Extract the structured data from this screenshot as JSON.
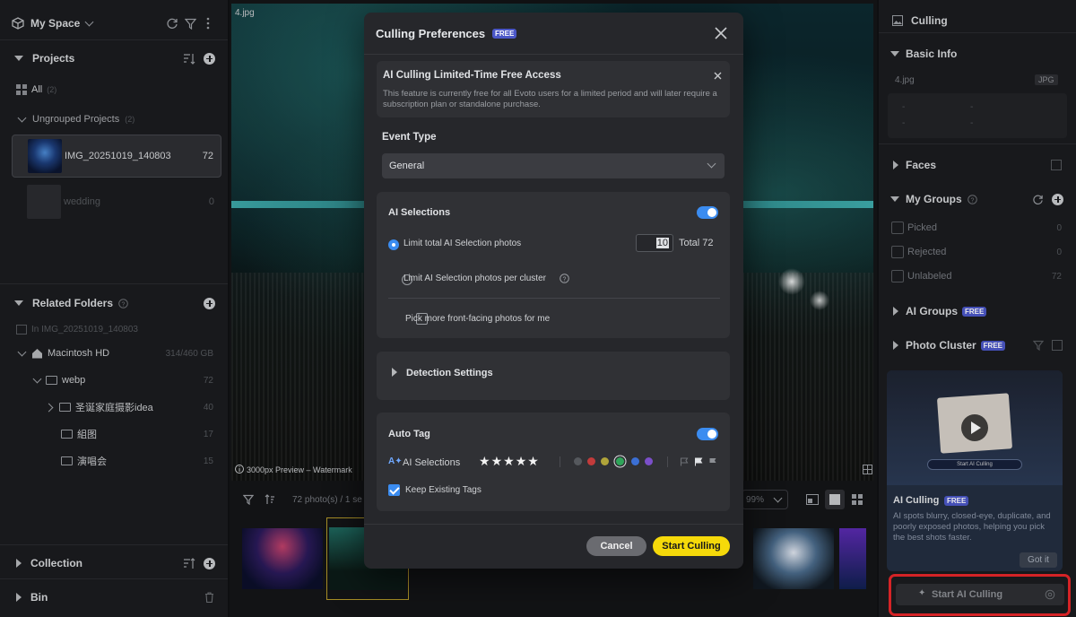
{
  "left": {
    "space_label": "My Space",
    "projects_title": "Projects",
    "all_label": "All",
    "all_count": "(2)",
    "ungrouped_label": "Ungrouped Projects",
    "ungrouped_count": "(2)",
    "projects": [
      {
        "name": "IMG_20251019_140803",
        "count": "72"
      },
      {
        "name": "wedding",
        "count": "0"
      }
    ],
    "related_title": "Related Folders",
    "in_path": "In IMG_20251019_140803",
    "drive_name": "Macintosh HD",
    "drive_size": "314/460 GB",
    "folders": [
      {
        "name": "webp",
        "count": "72"
      },
      {
        "name": "圣诞家庭摄影idea",
        "count": "40"
      },
      {
        "name": "組图",
        "count": "17"
      },
      {
        "name": "演唱会",
        "count": "15"
      }
    ],
    "collection_title": "Collection",
    "bin_title": "Bin"
  },
  "center": {
    "filename": "4.jpg",
    "preview_note": "3000px Preview – Watermark",
    "photo_count": "72 photo(s) / 1 se",
    "zoom": "99%"
  },
  "right": {
    "title": "Culling",
    "basic_info_title": "Basic Info",
    "file_name": "4.jpg",
    "file_type": "JPG",
    "dash": "-",
    "faces_title": "Faces",
    "groups_title": "My Groups",
    "groups": [
      {
        "label": "Picked",
        "count": "0"
      },
      {
        "label": "Rejected",
        "count": "0"
      },
      {
        "label": "Unlabeled",
        "count": "72"
      }
    ],
    "ai_groups_title": "AI Groups",
    "cluster_title": "Photo Cluster",
    "free_badge": "FREE",
    "promo_button": "Start AI Culling",
    "promo_title": "AI Culling",
    "promo_text": "AI spots blurry, closed-eye, duplicate, and poorly exposed photos, helping you pick the best shots faster.",
    "got_it": "Got it",
    "start_button": "Start AI Culling"
  },
  "modal": {
    "title": "Culling Preferences",
    "free_badge": "FREE",
    "banner_title": "AI Culling Limited-Time Free Access",
    "banner_text": "This feature is currently free for all Evoto users for a limited period and will later require a subscription plan or standalone purchase.",
    "event_type_label": "Event Type",
    "event_type_value": "General",
    "ai_selections_title": "AI Selections",
    "limit_total_label": "Limit total AI Selection photos",
    "limit_total_value": "10",
    "total_label": "Total 72",
    "limit_cluster_label": "Limit AI Selection photos per cluster",
    "front_facing_label": "Pick more front-facing photos for me",
    "detection_title": "Detection Settings",
    "auto_tag_title": "Auto Tag",
    "auto_tag_row_label": "AI Selections",
    "star_rating": 5,
    "keep_tags_label": "Keep Existing Tags",
    "cancel": "Cancel",
    "start": "Start Culling",
    "colors": {
      "accent": "#3b8cf0",
      "start": "#f5d90a",
      "dots": [
        "#55585d",
        "#c23b3b",
        "#b0a43a",
        "#2fa55a",
        "#3b6fd4",
        "#7b4fc9"
      ]
    }
  },
  "chart_data": null
}
